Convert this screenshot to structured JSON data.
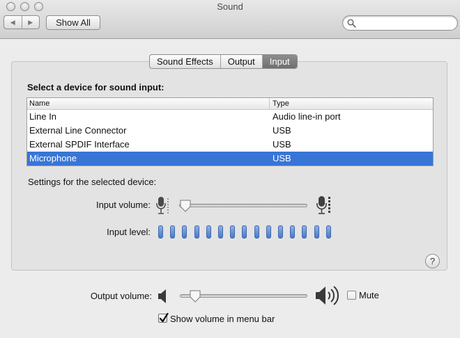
{
  "window": {
    "title": "Sound"
  },
  "toolbar": {
    "show_all_label": "Show All",
    "search_placeholder": ""
  },
  "tabs": [
    {
      "label": "Sound Effects",
      "active": false
    },
    {
      "label": "Output",
      "active": false
    },
    {
      "label": "Input",
      "active": true
    }
  ],
  "input_panel": {
    "heading": "Select a device for sound input:",
    "columns": {
      "name": "Name",
      "type": "Type"
    },
    "devices": [
      {
        "name": "Line In",
        "type": "Audio line-in port",
        "selected": false
      },
      {
        "name": "External Line Connector",
        "type": "USB",
        "selected": false
      },
      {
        "name": "External SPDIF Interface",
        "type": "USB",
        "selected": false
      },
      {
        "name": "Microphone",
        "type": "USB",
        "selected": true
      }
    ],
    "settings_label": "Settings for the selected device:",
    "input_volume_label": "Input volume:",
    "input_volume_level": 0.0,
    "input_level_label": "Input level:",
    "input_level_segments": 15,
    "input_level_lit": 15
  },
  "help_label": "?",
  "output": {
    "volume_label": "Output volume:",
    "volume_level": 0.08,
    "mute_label": "Mute",
    "mute_checked": false,
    "show_in_menubar_label": "Show volume in menu bar",
    "show_in_menubar_checked": true
  },
  "colors": {
    "selection": "#3875d7",
    "level_segment": "#4b78c5",
    "window_background": "#ececec"
  },
  "icons": {
    "back": "chevron-left-icon",
    "forward": "chevron-right-icon",
    "search": "search-icon",
    "mic_low": "microphone-low-icon",
    "mic_high": "microphone-high-icon",
    "speaker_low": "speaker-low-icon",
    "speaker_high": "speaker-high-icon",
    "help": "help-icon",
    "checkmark": "checkmark-icon"
  }
}
